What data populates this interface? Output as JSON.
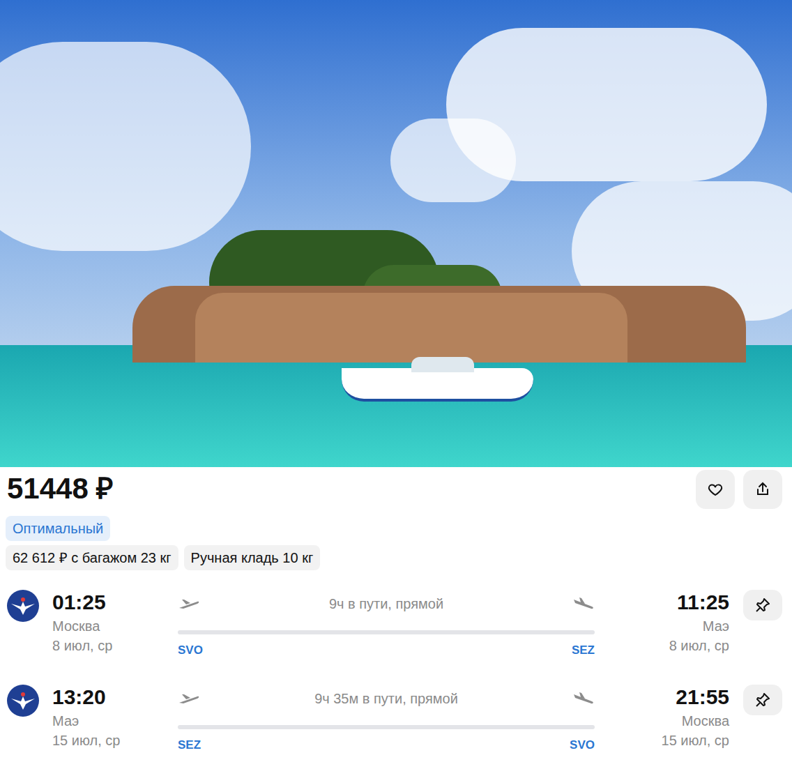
{
  "price": "51448 ₽",
  "fare": "Оптимальный",
  "options": [
    "62 612 ₽ с багажом 23 кг",
    "Ручная кладь 10 кг"
  ],
  "flights": [
    {
      "dep_time": "01:25",
      "dep_city": "Москва",
      "dep_date": "8 июл, ср",
      "duration": "9ч в пути, прямой",
      "from": "SVO",
      "to": "SEZ",
      "arr_time": "11:25",
      "arr_city": "Маэ",
      "arr_date": "8 июл, ср"
    },
    {
      "dep_time": "13:20",
      "dep_city": "Маэ",
      "dep_date": "15 июл, ср",
      "duration": "9ч 35м в пути, прямой",
      "from": "SEZ",
      "to": "SVO",
      "arr_time": "21:55",
      "arr_city": "Москва",
      "arr_date": "15 июл, ср"
    }
  ]
}
